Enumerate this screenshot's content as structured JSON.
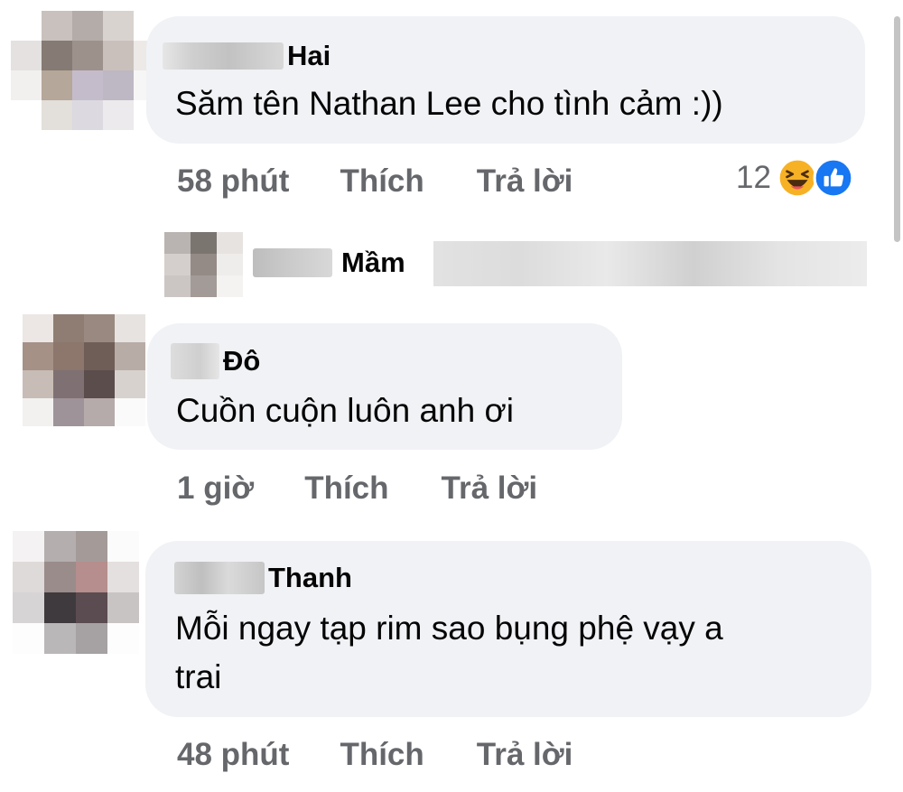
{
  "comments": [
    {
      "author": "Hai",
      "text": "Săm tên Nathan Lee cho tình cảm :))",
      "time": "58 phút",
      "like_label": "Thích",
      "reply_label": "Trả lời",
      "reaction_count": "12",
      "reactions": [
        "haha-icon",
        "like-icon"
      ]
    },
    {
      "author": "Đô",
      "text": "Cuồn cuộn luôn anh ơi",
      "time": "1 giờ",
      "like_label": "Thích",
      "reply_label": "Trả lời"
    },
    {
      "author": "Thanh",
      "text_line1": "Mỗi ngay tạp rim sao bụng phệ vạy a",
      "text_line2": "trai",
      "time": "48 phút",
      "like_label": "Thích",
      "reply_label": "Trả lời"
    }
  ],
  "reply_preview": {
    "author": "Mầm"
  },
  "colors": {
    "bubble": "#f0f2f5",
    "secondary_text": "#65676b",
    "like_blue": "#1877f2",
    "haha_yellow": "#f7b125"
  }
}
